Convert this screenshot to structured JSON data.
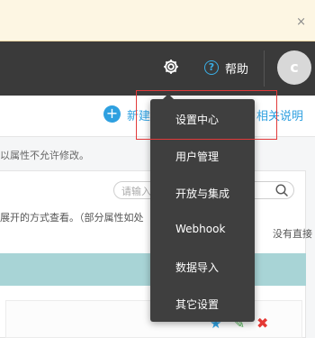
{
  "notice": {
    "close_glyph": "×"
  },
  "topbar": {
    "settings_icon": "gear-icon",
    "help_icon_glyph": "?",
    "help_label": "帮助",
    "avatar_letter": "c"
  },
  "toolbar": {
    "new_glyph": "+",
    "new_label": "新建",
    "related_label": "相关说明"
  },
  "content": {
    "hint": "以属性不允许修改。",
    "search_placeholder": "请输入",
    "description_line1": "展开的方式查看。（部分属性如处",
    "description_line2": "没有直接"
  },
  "dropdown": {
    "items": [
      {
        "label": "设置中心"
      },
      {
        "label": "用户管理"
      },
      {
        "label": "开放与集成"
      },
      {
        "label": "Webhook"
      },
      {
        "label": "数据导入"
      },
      {
        "label": "其它设置"
      }
    ]
  },
  "row_actions": {
    "star_glyph": "★",
    "edit_glyph": "✎",
    "delete_glyph": "✖"
  },
  "colors": {
    "topbar": "#3a3a3a",
    "accent": "#2ea0e0",
    "dropdown_bg": "#3f3f3f",
    "highlight": "#e23a3a",
    "teal_band": "#a8d4d6",
    "notice_bg": "#fdf6e3"
  }
}
